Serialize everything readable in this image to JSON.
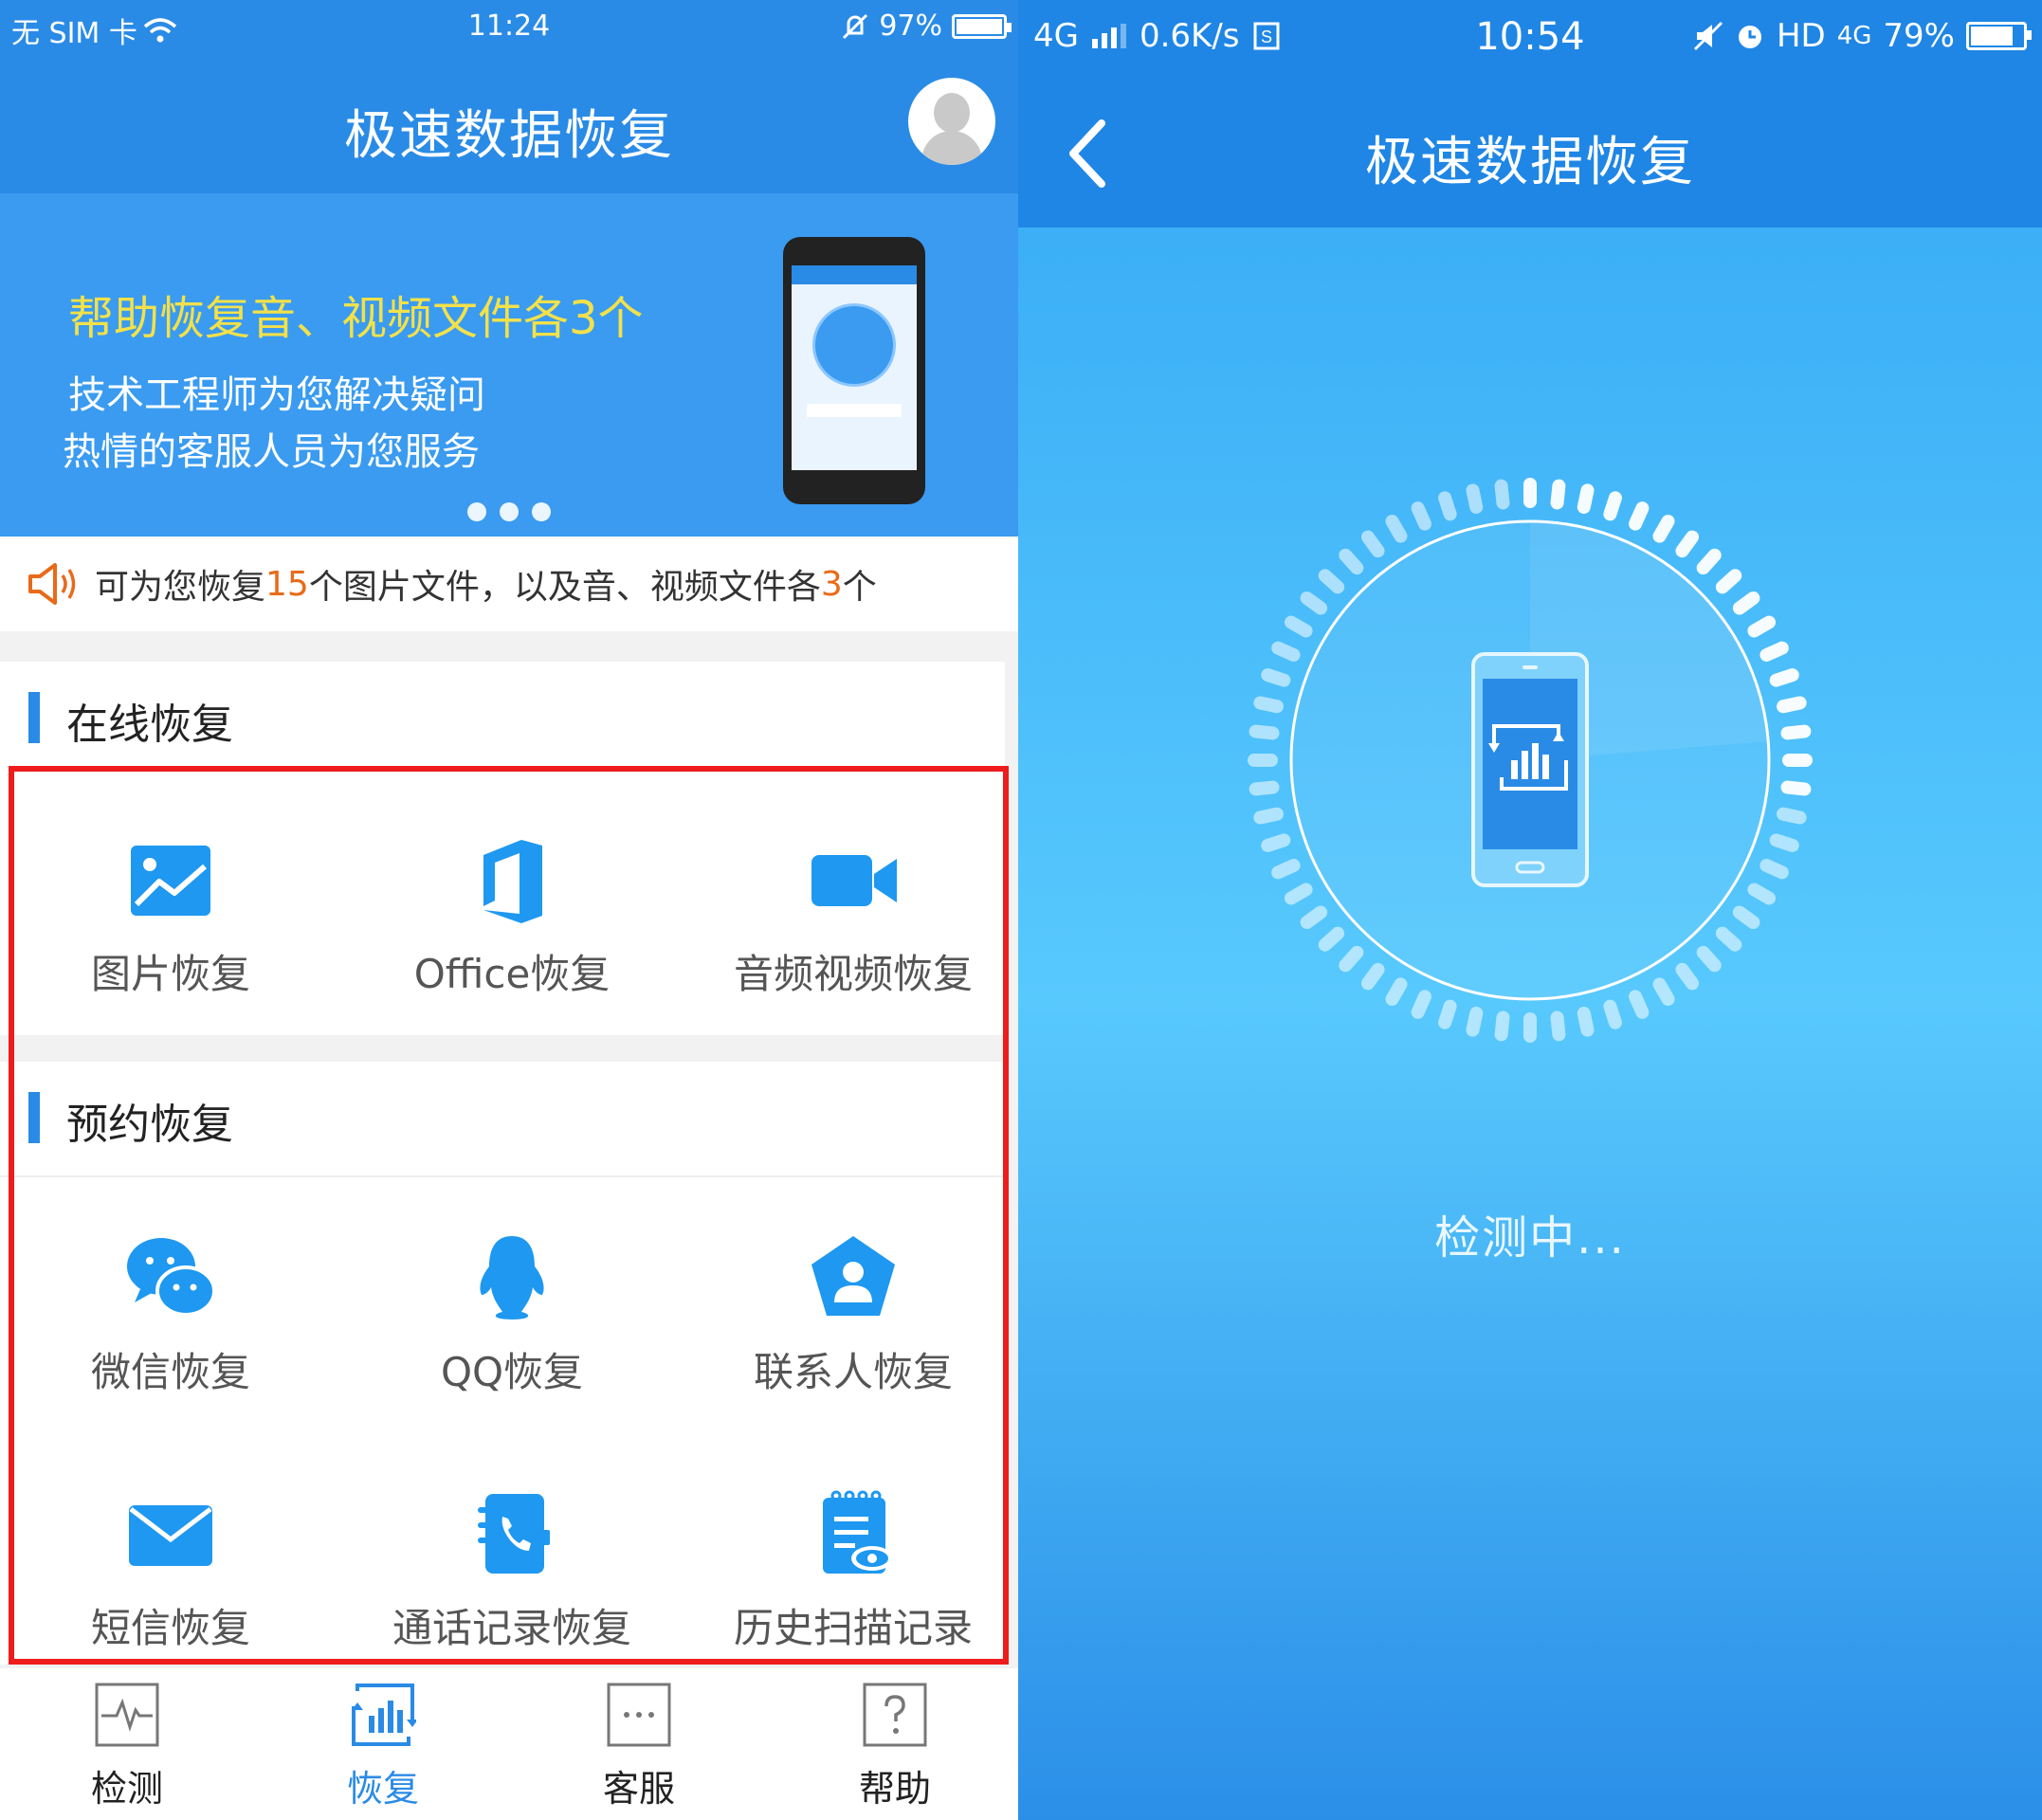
{
  "left": {
    "status_bar": {
      "carrier": "无 SIM 卡",
      "time": "11:24",
      "battery": "97%",
      "battery_level": 0.97
    },
    "title": "极速数据恢复",
    "banner": {
      "headline": "帮助恢复音、视频文件各3个",
      "line1": "技术工程师为您解决疑问",
      "line2": "热情的客服人员为您服务",
      "page_count": 3
    },
    "notice": {
      "part1": "可为您恢复",
      "count1": "15",
      "part2": "个图片文件，以及音、视频文件各",
      "count2": "3",
      "part3": "个"
    },
    "online_section": {
      "title": "在线恢复",
      "items": [
        {
          "label": "图片恢复",
          "icon": "image-icon"
        },
        {
          "label": "Office恢复",
          "icon": "office-icon"
        },
        {
          "label": "音频视频恢复",
          "icon": "video-camera-icon"
        }
      ]
    },
    "booking_section": {
      "title": "预约恢复",
      "items": [
        {
          "label": "微信恢复",
          "icon": "wechat-icon"
        },
        {
          "label": "QQ恢复",
          "icon": "qq-penguin-icon"
        },
        {
          "label": "联系人恢复",
          "icon": "contact-icon"
        },
        {
          "label": "短信恢复",
          "icon": "envelope-icon"
        },
        {
          "label": "通话记录恢复",
          "icon": "phone-book-icon"
        },
        {
          "label": "历史扫描记录",
          "icon": "notebook-eye-icon"
        }
      ]
    },
    "tabs": [
      {
        "label": "检测",
        "icon": "pulse-icon",
        "active": false
      },
      {
        "label": "恢复",
        "icon": "restore-chart-icon",
        "active": true
      },
      {
        "label": "客服",
        "icon": "chat-dots-icon",
        "active": false
      },
      {
        "label": "帮助",
        "icon": "help-icon",
        "active": false
      }
    ]
  },
  "right": {
    "status_bar": {
      "network": "4G",
      "speed": "0.6K/s",
      "time": "10:54",
      "hd": "HD",
      "network2": "4G",
      "battery": "79%",
      "battery_level": 0.79
    },
    "title": "极速数据恢复",
    "status_text": "检测中..."
  },
  "colors": {
    "primary_blue": "#2a8be6",
    "banner_yellow": "#f3e14a",
    "highlight_orange": "#e96a1a",
    "red_box": "#ee1c1c"
  }
}
